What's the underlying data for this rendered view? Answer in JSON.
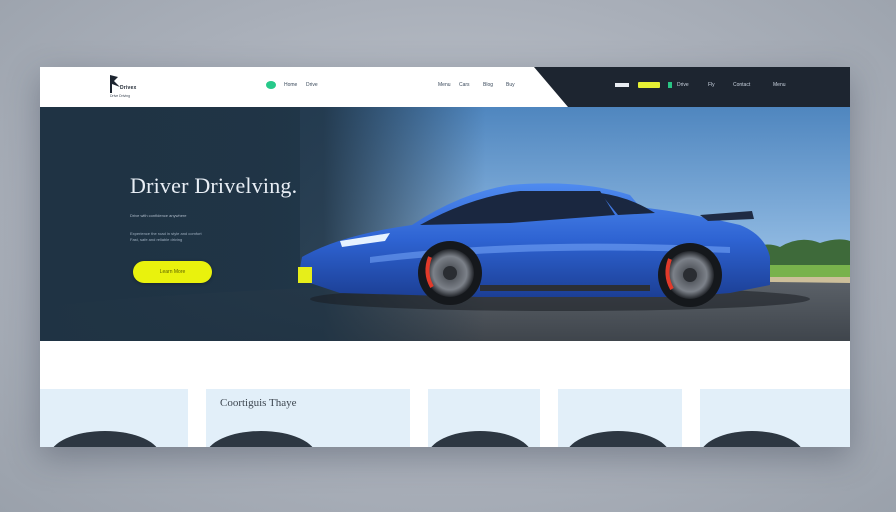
{
  "header": {
    "logo_text": "Drivex",
    "logo_sub": "Drive Driving",
    "nav_left": [
      "Home",
      "Drive"
    ],
    "nav_mid": [
      "Menu",
      "Cars",
      "Blog",
      "Buy"
    ],
    "nav_right": [
      "Drive",
      "Fly",
      "Contact",
      "Menu"
    ]
  },
  "hero": {
    "title": "Driver Drivelving.",
    "subtitle": "Drive with confidence anywhere",
    "desc_line1": "Experience the road in style and comfort",
    "desc_line2": "Fast, safe and reliable driving",
    "cta_label": "Learn More"
  },
  "cards": {
    "card2_title": "Coortiguis Thaye"
  },
  "colors": {
    "accent_yellow": "#e9f20d",
    "accent_green": "#27c98a",
    "header_dark": "#1d2530",
    "car_blue": "#2f67d8"
  }
}
